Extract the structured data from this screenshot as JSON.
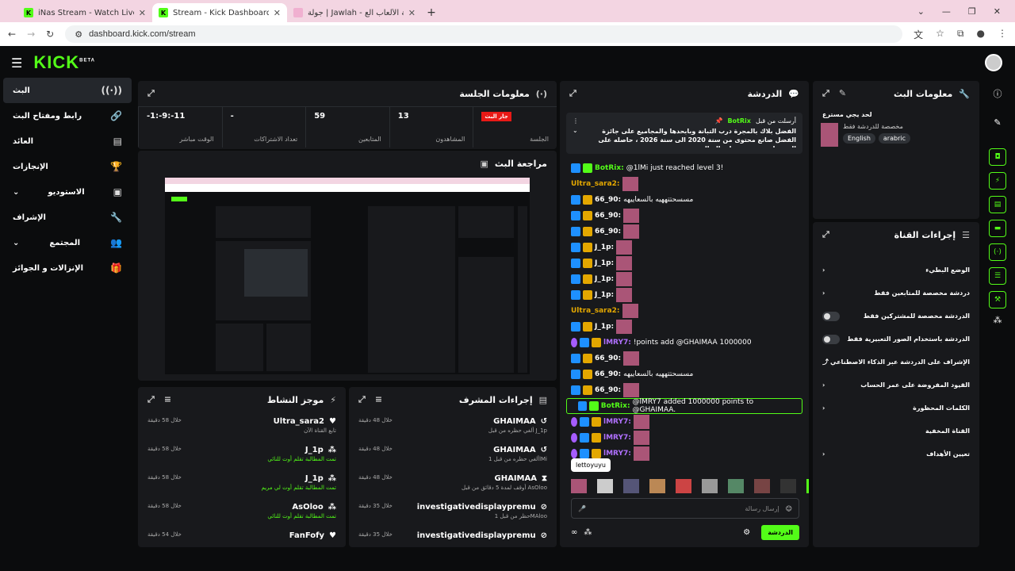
{
  "browser": {
    "tabs": [
      {
        "title": "iNas Stream - Watch Live on Kick"
      },
      {
        "title": "Stream - Kick Dashboard"
      },
      {
        "title": "جولة | Jawlah - منصة الألعاب الع"
      }
    ],
    "url": "dashboard.kick.com/stream"
  },
  "logo": "KICK",
  "logo_beta": "BETA",
  "nav": [
    {
      "label": "البث"
    },
    {
      "label": "رابط ومفتاح البث"
    },
    {
      "label": "العائد"
    },
    {
      "label": "الإنجازات"
    },
    {
      "label": "الاستوديو"
    },
    {
      "label": "الإشراف"
    },
    {
      "label": "المجتمع"
    },
    {
      "label": "الإنزالات و الجوائز"
    }
  ],
  "session": {
    "title": "معلومات الجلسة",
    "live_badge": "جار البث",
    "stats": [
      {
        "value": "",
        "label": "الجلسة"
      },
      {
        "value": "13",
        "label": "المشاهدون"
      },
      {
        "value": "59",
        "label": "المتابعين"
      },
      {
        "value": "-",
        "label": "تعداد الاشتراكات"
      },
      {
        "value": "-1:-9:-11",
        "label": "الوقت مباشر"
      }
    ]
  },
  "preview": {
    "title": "مراجعة البث"
  },
  "activity": {
    "title": "موجز النشاط",
    "items": [
      {
        "name": "Ultra_sara2",
        "sub": "تابع القناة الآن",
        "time": "خلال 58 دقيقة",
        "green": false
      },
      {
        "name": "J_1p",
        "sub": "تمت المطالبة تقلم أوت للنائي",
        "time": "خلال 58 دقيقة",
        "green": true
      },
      {
        "name": "J_1p",
        "sub": "تمت المطالبة تقلم أوت لي مريم",
        "time": "خلال 58 دقيقة",
        "green": true
      },
      {
        "name": "AsOloo",
        "sub": "تمت المطالبة تقلم أوت للنائي",
        "time": "خلال 58 دقيقة",
        "green": true
      },
      {
        "name": "FanFofy",
        "sub": "",
        "time": "خلال 54 دقيقة",
        "green": false
      }
    ]
  },
  "mod_actions": {
    "title": "إجراءات المشرف",
    "items": [
      {
        "name": "GHAIMAA",
        "sub": "ألغي حظره من قبل J_1p",
        "time": "خلال 48 دقيقة"
      },
      {
        "name": "GHAIMAA",
        "sub": "ألغي حظره من قبل 1lMi",
        "time": "خلال 48 دقيقة"
      },
      {
        "name": "GHAIMAA",
        "sub": "أوقف لمدة 5 دقائق من قبل AsOloo",
        "time": "خلال 48 دقيقة"
      },
      {
        "name": "investigativedisplaypremu",
        "sub": "حظر من قبل 1MAloo",
        "time": "خلال 35 دقيقة"
      },
      {
        "name": "investigativedisplaypremu",
        "sub": "",
        "time": "خلال 35 دقيقة"
      }
    ]
  },
  "chat": {
    "title": "الدردشة",
    "pinned_by": "أرسلت من قبل",
    "pinned_user": "BotRix",
    "pinned_text": "الفضل بلاك بالمجرة درب التبانة وبابحدها والمجاميع على جائزة الفضل صانع محتوى من سنة 2020 الى سنة 2026 ، حاصله على الجوي اورنز مرتين على التوالي ...",
    "messages": [
      {
        "user": "BotRix",
        "text": "@1lMi just reached level 3!",
        "color": "#53fc18"
      },
      {
        "user": "Ultra_sara2",
        "text": "",
        "color": "#e3a700"
      },
      {
        "user": "66_90",
        "text": "مسسحتتههيه بالسعاييهه",
        "color": "#fff"
      },
      {
        "user": "66_90",
        "text": "",
        "color": "#fff"
      },
      {
        "user": "66_90",
        "text": "",
        "color": "#fff"
      },
      {
        "user": "J_1p",
        "text": "",
        "color": "#fff"
      },
      {
        "user": "J_1p",
        "text": "",
        "color": "#fff"
      },
      {
        "user": "J_1p",
        "text": "",
        "color": "#fff"
      },
      {
        "user": "J_1p",
        "text": "",
        "color": "#fff"
      },
      {
        "user": "Ultra_sara2",
        "text": "",
        "color": "#e3a700"
      },
      {
        "user": "J_1p",
        "text": "",
        "color": "#fff"
      },
      {
        "user": "lMRY7",
        "text": "!points add @GHAIMAA 1000000",
        "color": "#b070ff"
      },
      {
        "user": "66_90",
        "text": "",
        "color": "#fff"
      },
      {
        "user": "66_90",
        "text": "مسسحتتههيه بالسعاييهه",
        "color": "#fff"
      },
      {
        "user": "66_90",
        "text": "",
        "color": "#fff"
      },
      {
        "user": "BotRix",
        "text": "@lMRY7 added 1000000 points to @GHAIMAA.",
        "color": "#53fc18"
      },
      {
        "user": "lMRY7",
        "text": "",
        "color": "#b070ff"
      },
      {
        "user": "lMRY7",
        "text": "",
        "color": "#b070ff"
      },
      {
        "user": "lMRY7",
        "text": "",
        "color": "#b070ff"
      }
    ],
    "tooltip": "lettoyuyu",
    "input_placeholder": "إرسال رسالة",
    "send_label": "الدردشة"
  },
  "stream_info": {
    "title": "معلومات البث",
    "stream_title": "لحد يجي مسترع",
    "category": "مخصصة للدردشة فقط",
    "tags": [
      "English",
      "arabric"
    ]
  },
  "channel_actions": {
    "title": "إجراءات القناة",
    "items": [
      {
        "label": "الوضع البطيء",
        "type": "chevron"
      },
      {
        "label": "دردشة مخصصة للمتابعين فقط",
        "type": "chevron"
      },
      {
        "label": "الدردشة مخصصة للمشتركين فقط",
        "type": "toggle"
      },
      {
        "label": "الدردشة باستخدام الصور التعبيرية فقط",
        "type": "toggle"
      },
      {
        "label": "الإشراف على الدردشة عبر الذكاء الاصطناعي",
        "type": "link"
      },
      {
        "label": "القيود المفروضة على عمر الحساب",
        "type": "chevron"
      },
      {
        "label": "الكلمات المحظورة",
        "type": "chevron"
      },
      {
        "label": "القناة المخفية",
        "type": "none"
      },
      {
        "label": "تعيين الأهداف",
        "type": "chevron"
      }
    ]
  }
}
